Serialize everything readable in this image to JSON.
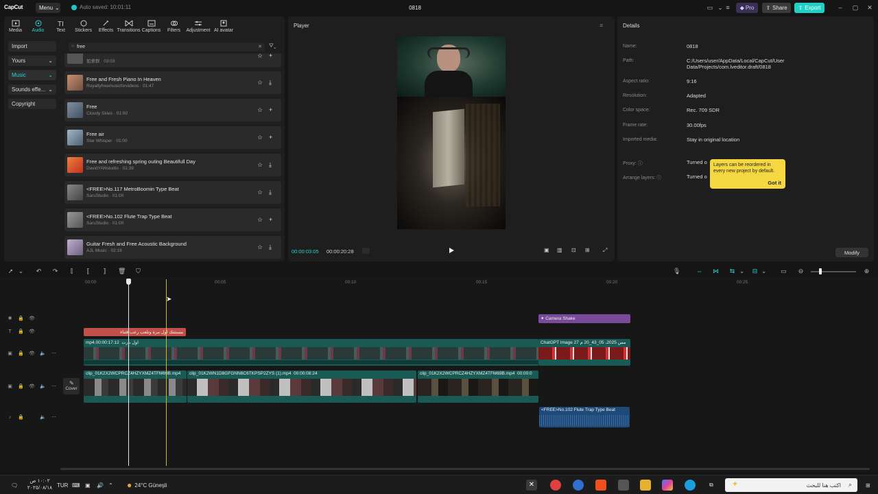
{
  "app": {
    "logo": "CapCut",
    "menu_label": "Menu",
    "autosave": "Auto saved: 10:01:11",
    "project_title": "0818",
    "pro_label": "Pro",
    "share_label": "Share",
    "export_label": "Export",
    "accent": "#1fd1c5"
  },
  "toolbar": {
    "tabs": [
      {
        "label": "Media",
        "icon": "media-icon"
      },
      {
        "label": "Audio",
        "icon": "audio-icon",
        "active": true
      },
      {
        "label": "Text",
        "icon": "text-icon"
      },
      {
        "label": "Stickers",
        "icon": "stickers-icon"
      },
      {
        "label": "Effects",
        "icon": "effects-icon"
      },
      {
        "label": "Transitions",
        "icon": "transitions-icon"
      },
      {
        "label": "Captions",
        "icon": "captions-icon"
      },
      {
        "label": "Filters",
        "icon": "filters-icon"
      },
      {
        "label": "Adjustment",
        "icon": "adjustment-icon"
      },
      {
        "label": "AI avatar",
        "icon": "ai-avatar-icon"
      }
    ]
  },
  "sidebar": {
    "items": [
      {
        "label": "Import"
      },
      {
        "label": "Yours",
        "chevron": true
      },
      {
        "label": "Music",
        "chevron": true,
        "active": true
      },
      {
        "label": "Sounds effe...",
        "chevron": true
      },
      {
        "label": "Copyright"
      }
    ]
  },
  "search": {
    "value": "free"
  },
  "music": {
    "items": [
      {
        "title": "",
        "sub": "如意群 · 03:03",
        "action": "add",
        "thumb": "#555"
      },
      {
        "title": "Free and Fresh Piano In Heaven",
        "sub": "Royaltyfreemusicforvideos · 01:47",
        "action": "download",
        "thumb": "#b08060"
      },
      {
        "title": "Free",
        "sub": "Cloudy Skies · 01:00",
        "action": "add",
        "thumb": "#607080"
      },
      {
        "title": "Free air",
        "sub": "Star Whisper · 01:00",
        "action": "add",
        "thumb": "#7a90a0"
      },
      {
        "title": "Free and refreshing spring outing Beautifull Day",
        "sub": "DavidYANstudio · 01:39",
        "action": "download",
        "thumb": "#d05030"
      },
      {
        "title": "<FREE>No.117 MetroBoomin Type Beat",
        "sub": "SaruStudio · 01:00",
        "action": "download",
        "thumb": "#666"
      },
      {
        "title": "<FREE>No.102 Flute Trap Type Beat",
        "sub": "SaruStudio · 01:00",
        "action": "add",
        "thumb": "#777"
      },
      {
        "title": "Guitar Fresh and Free Acoustic Background",
        "sub": "AJL Music · 02:19",
        "action": "download",
        "thumb": "#a090b0"
      }
    ]
  },
  "player": {
    "title": "Player",
    "time_current": "00:00:03:05",
    "time_total": "00:00:20:28"
  },
  "details": {
    "title": "Details",
    "rows": [
      {
        "label": "Name:",
        "value": "0818"
      },
      {
        "label": "Path:",
        "value": "C:/Users/user/AppData/Local/CapCut/User Data/Projects/com.lveditor.draft/0818"
      },
      {
        "label": "Aspect ratio:",
        "value": "9:16"
      },
      {
        "label": "Resolution:",
        "value": "Adapted"
      },
      {
        "label": "Color space:",
        "value": "Rec. 709 SDR"
      },
      {
        "label": "Frame rate:",
        "value": "30.00fps"
      },
      {
        "label": "Imported media:",
        "value": "Stay in original location"
      },
      {
        "label": "Proxy:",
        "value": "Turned o"
      },
      {
        "label": "Arrange layers:",
        "value": "Turned o"
      }
    ],
    "tooltip_text": "Layers can be reordered in every new project by default.",
    "tooltip_button": "Got it",
    "modify_label": "Modify"
  },
  "timeline": {
    "ticks": [
      "00:00",
      "00:05",
      "00:10",
      "00:15",
      "00:20",
      "00:25"
    ],
    "effect_clip": "Camera Shake",
    "text_clip": "مستنتك اول مرة وتلعب رعب فثناء",
    "main_clip_label": "mp4.اول نارت",
    "main_clip_time": "00:00:17:12",
    "image_clip_label": "ChatGPT Image 27 مس 2025، 05_43_20 م",
    "video_clips": [
      {
        "label": "clip_01K2X2WCPRCZ4HZYXMZ4TFM69B.mp4"
      },
      {
        "label": "clip_01K2WN1D8GFGNN8C6TKPSP2ZYS (1).mp4",
        "time": "00:00:08:24"
      },
      {
        "label": "clip_01K2X2WCPRCZ4HZYXMZ4TFM69B.mp4",
        "time": "00:00:0"
      }
    ],
    "audio_clip": "<FREE>No.102 Flute Trap Type Beat",
    "cover_label": "Cover"
  },
  "taskbar": {
    "time": "١٠:٠٢ ص",
    "date": "٢٠٢٥/٠٨/١٨",
    "lang": "TUR",
    "weather": "24°C  Güneşli",
    "search_placeholder": "اكتب هنا للبحث"
  }
}
